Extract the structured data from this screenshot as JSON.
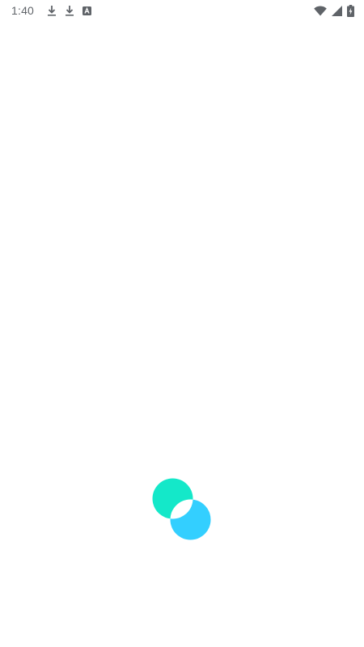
{
  "status_bar": {
    "time": "1:40",
    "left_icons": [
      "download-icon",
      "download-icon",
      "app-notification-icon"
    ],
    "right_icons": [
      "wifi-icon",
      "cellular-signal-icon",
      "battery-charging-icon"
    ]
  },
  "splash": {
    "logo": "overlapping-circles-logo",
    "colors": {
      "top_circle": "#14E8C9",
      "bottom_circle": "#33CFFF",
      "overlap": "#FFFFFF"
    }
  }
}
